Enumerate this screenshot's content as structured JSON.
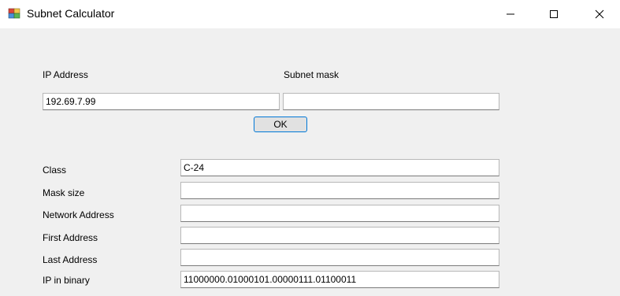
{
  "window": {
    "title": "Subnet Calculator",
    "icon": "app-icon",
    "controls": [
      "minimize-icon",
      "maximize-icon",
      "close-icon"
    ]
  },
  "input": {
    "ip_label": "IP Address",
    "ip_value": "192.69.7.99",
    "mask_label": "Subnet mask",
    "mask_value": "",
    "ok_label": "OK"
  },
  "results": [
    {
      "label": "Class",
      "value": "C-24"
    },
    {
      "label": "Mask size",
      "value": ""
    },
    {
      "label": "Network Address",
      "value": ""
    },
    {
      "label": "First Address",
      "value": ""
    },
    {
      "label": "Last Address",
      "value": ""
    },
    {
      "label": "IP in binary",
      "value": "11000000.01000101.00000111.01100011"
    }
  ],
  "colors": {
    "titlebar": "#ffffff",
    "client": "#f0f0f0",
    "button_focus_border": "#0078d7"
  }
}
